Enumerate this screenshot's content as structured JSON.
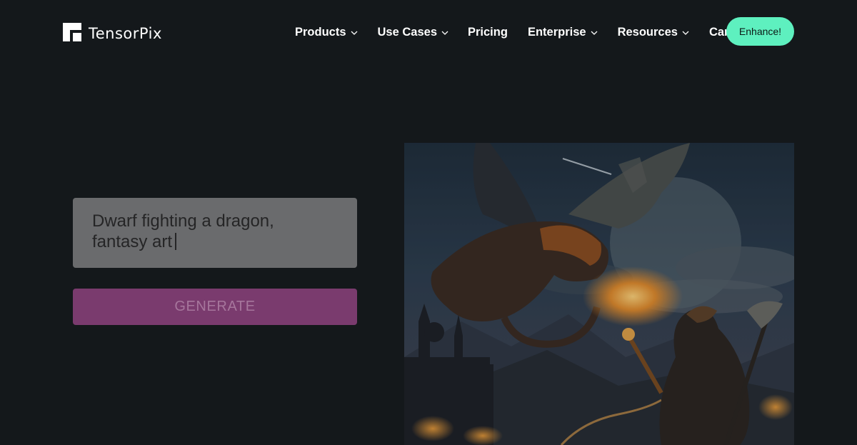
{
  "brand": {
    "name": "TensorPix",
    "logo_icon": "tensorpix-logo-icon"
  },
  "nav": {
    "items": [
      {
        "label": "Products",
        "dropdown": true
      },
      {
        "label": "Use Cases",
        "dropdown": true
      },
      {
        "label": "Pricing",
        "dropdown": false
      },
      {
        "label": "Enterprise",
        "dropdown": true
      },
      {
        "label": "Resources",
        "dropdown": true
      },
      {
        "label": "Careers",
        "dropdown": false
      }
    ],
    "cta_label": "Enhance!"
  },
  "generator": {
    "prompt_line1": "Dwarf fighting a dragon,",
    "prompt_line2": "fantasy art",
    "button_label": "GENERATE"
  },
  "colors": {
    "background": "#14181b",
    "accent": "#5ef0bf",
    "generate_button": "#7a3b6e",
    "prompt_box": "#6a6b6d"
  }
}
